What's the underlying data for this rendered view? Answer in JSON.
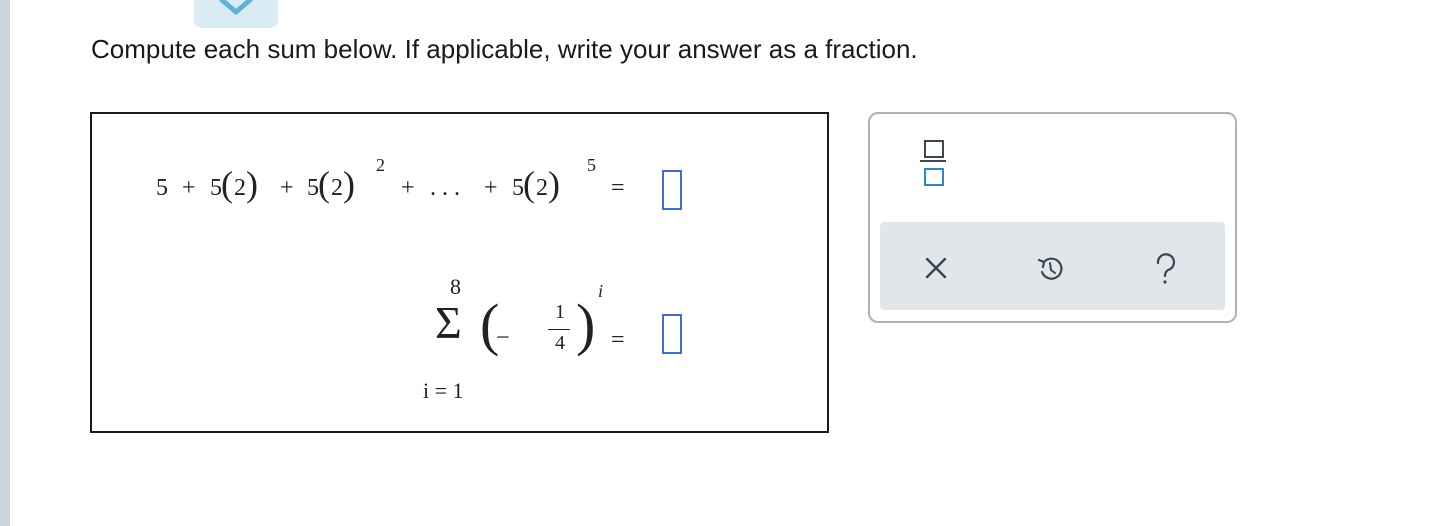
{
  "instruction": "Compute each sum below. If applicable, write your answer as a fraction.",
  "problem1": {
    "five": "5",
    "plus": "+",
    "two": "2",
    "exp2": "2",
    "dots": ". . .",
    "exp5": "5",
    "equals": "="
  },
  "problem2": {
    "upper": "8",
    "sigma": "Σ",
    "lower": "i = 1",
    "exponent": "i",
    "minus": "−",
    "numerator": "1",
    "denominator": "4",
    "equals": "="
  },
  "palette": {
    "tools": [
      "fraction-icon",
      "clear-icon",
      "undo-icon",
      "help-icon"
    ]
  },
  "colors": {
    "answer_border": "#3b6fd6",
    "palette_strip": "#e1e6ea",
    "left_bar": "#cdd5db",
    "tab": "#d9ebf3"
  }
}
